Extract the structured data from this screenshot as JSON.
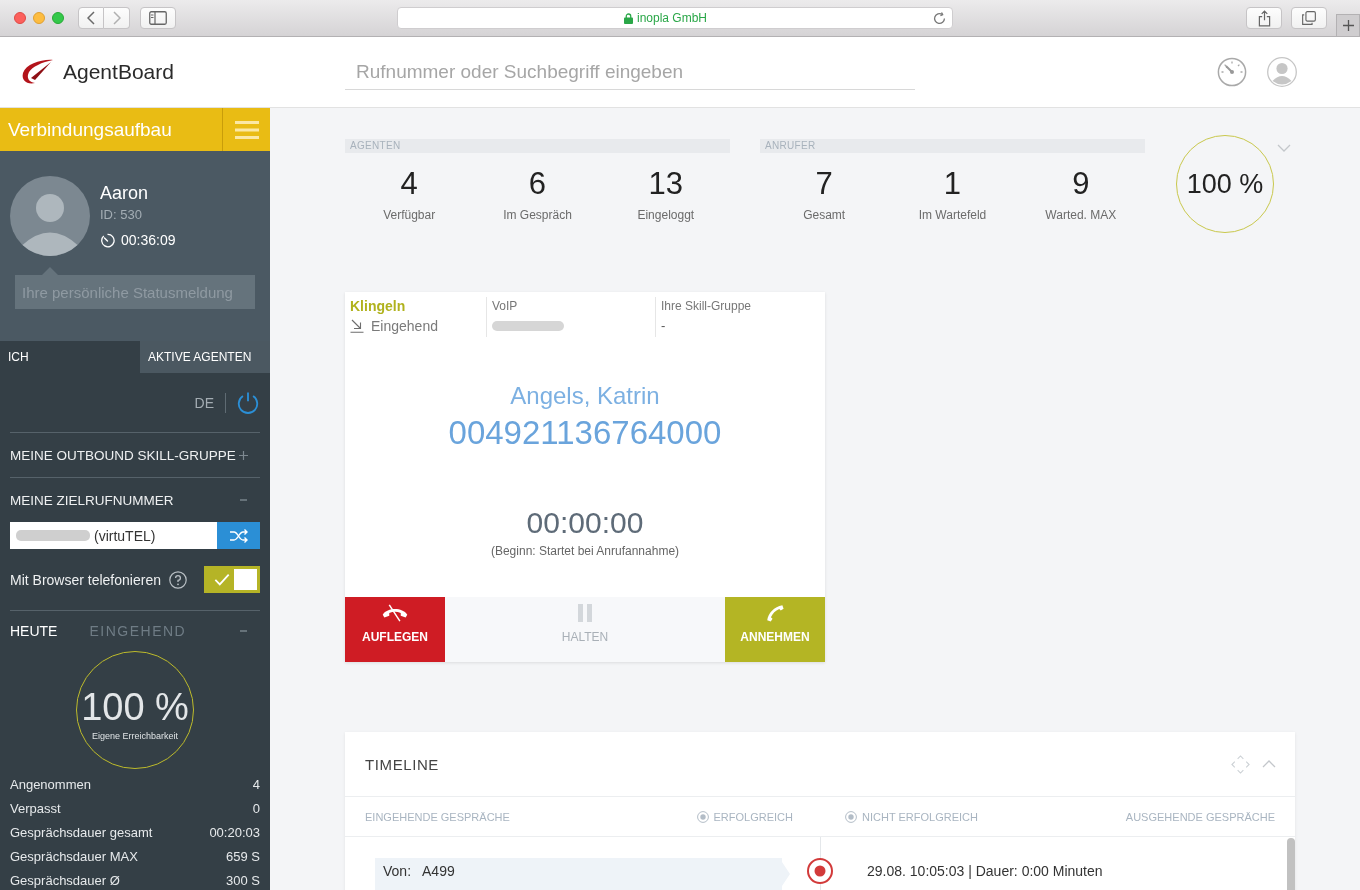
{
  "browser": {
    "address": "inopla GmbH"
  },
  "header": {
    "logo": "AgentBoard",
    "search": {
      "placeholder": "Rufnummer oder Suchbegriff eingeben"
    }
  },
  "sidebar": {
    "status_bar": {
      "label": "Verbindungsaufbau"
    },
    "profile": {
      "name": "Aaron",
      "id": "ID: 530",
      "timer": "00:36:09",
      "status": {
        "placeholder": "Ihre persönliche Statusmeldung"
      }
    },
    "tabs": [
      {
        "label": "ICH",
        "selected": true
      },
      {
        "label": "AKTIVE AGENTEN",
        "selected": false
      }
    ],
    "language": "DE",
    "sections": [
      {
        "label": "MEINE OUTBOUND SKILL-GRUPPE",
        "expanded": false
      },
      {
        "label": "MEINE ZIELRUFNUMMER",
        "expanded": true,
        "field": {
          "value": "(virtuTEL)"
        }
      }
    ],
    "browser_phone": {
      "label": "Mit Browser telefonieren",
      "on": true
    },
    "today": {
      "expanded": true,
      "tabs": [
        {
          "label": "HEUTE",
          "selected": true
        },
        {
          "label": "EINGEHEND",
          "selected": false
        }
      ],
      "reachability": {
        "value": "100 %",
        "caption": "Eigene Erreichbarkeit"
      },
      "stats": [
        {
          "label": "Angenommen",
          "value": "4"
        },
        {
          "label": "Verpasst",
          "value": "0"
        },
        {
          "label": "Gesprächsdauer gesamt",
          "value": "00:20:03"
        },
        {
          "label": "Gesprächsdauer MAX",
          "value": "659 S"
        },
        {
          "label": "Gesprächsdauer Ø",
          "value": "300 S"
        }
      ]
    }
  },
  "main": {
    "groups": [
      {
        "title": "AGENTEN",
        "metrics": [
          {
            "value": "4",
            "label": "Verfügbar"
          },
          {
            "value": "6",
            "label": "Im Gespräch"
          },
          {
            "value": "13",
            "label": "Eingeloggt"
          }
        ]
      },
      {
        "title": "ANRUFER",
        "metrics": [
          {
            "value": "7",
            "label": "Gesamt"
          },
          {
            "value": "1",
            "label": "Im Wartefeld"
          },
          {
            "value": "9",
            "label": "Warted. MAX"
          }
        ]
      }
    ],
    "service_level": "100 %",
    "call": {
      "status": "Klingeln",
      "direction": "Eingehend",
      "line": {
        "label": "VoIP"
      },
      "skill_group": {
        "label": "Ihre Skill-Gruppe",
        "value": "-"
      },
      "caller": {
        "name": "Angels, Katrin",
        "number": "004921136764000"
      },
      "duration": "00:00:00",
      "duration_note": "(Beginn: Startet bei Anrufannahme)",
      "actions": [
        {
          "label": "AUFLEGEN",
          "kind": "hangup",
          "disabled": false
        },
        {
          "label": "HALTEN",
          "kind": "hold",
          "disabled": true
        },
        {
          "label": "ANNEHMEN",
          "kind": "answer",
          "disabled": false
        }
      ]
    },
    "timeline": {
      "title": "TIMELINE",
      "expanded": true,
      "filters": {
        "incoming": "EINGEHENDE GESPRÄCHE",
        "options": [
          {
            "label": "ERFOLGREICH",
            "checked": true
          },
          {
            "label": "NICHT ERFOLGREICH",
            "checked": true
          }
        ],
        "outgoing": "AUSGEHENDE GESPRÄCHE"
      },
      "entries": [
        {
          "from_label": "Von:",
          "from": "A499",
          "summary": "29.08. 10:05:03 | Dauer: 0:00 Minuten"
        }
      ]
    }
  }
}
